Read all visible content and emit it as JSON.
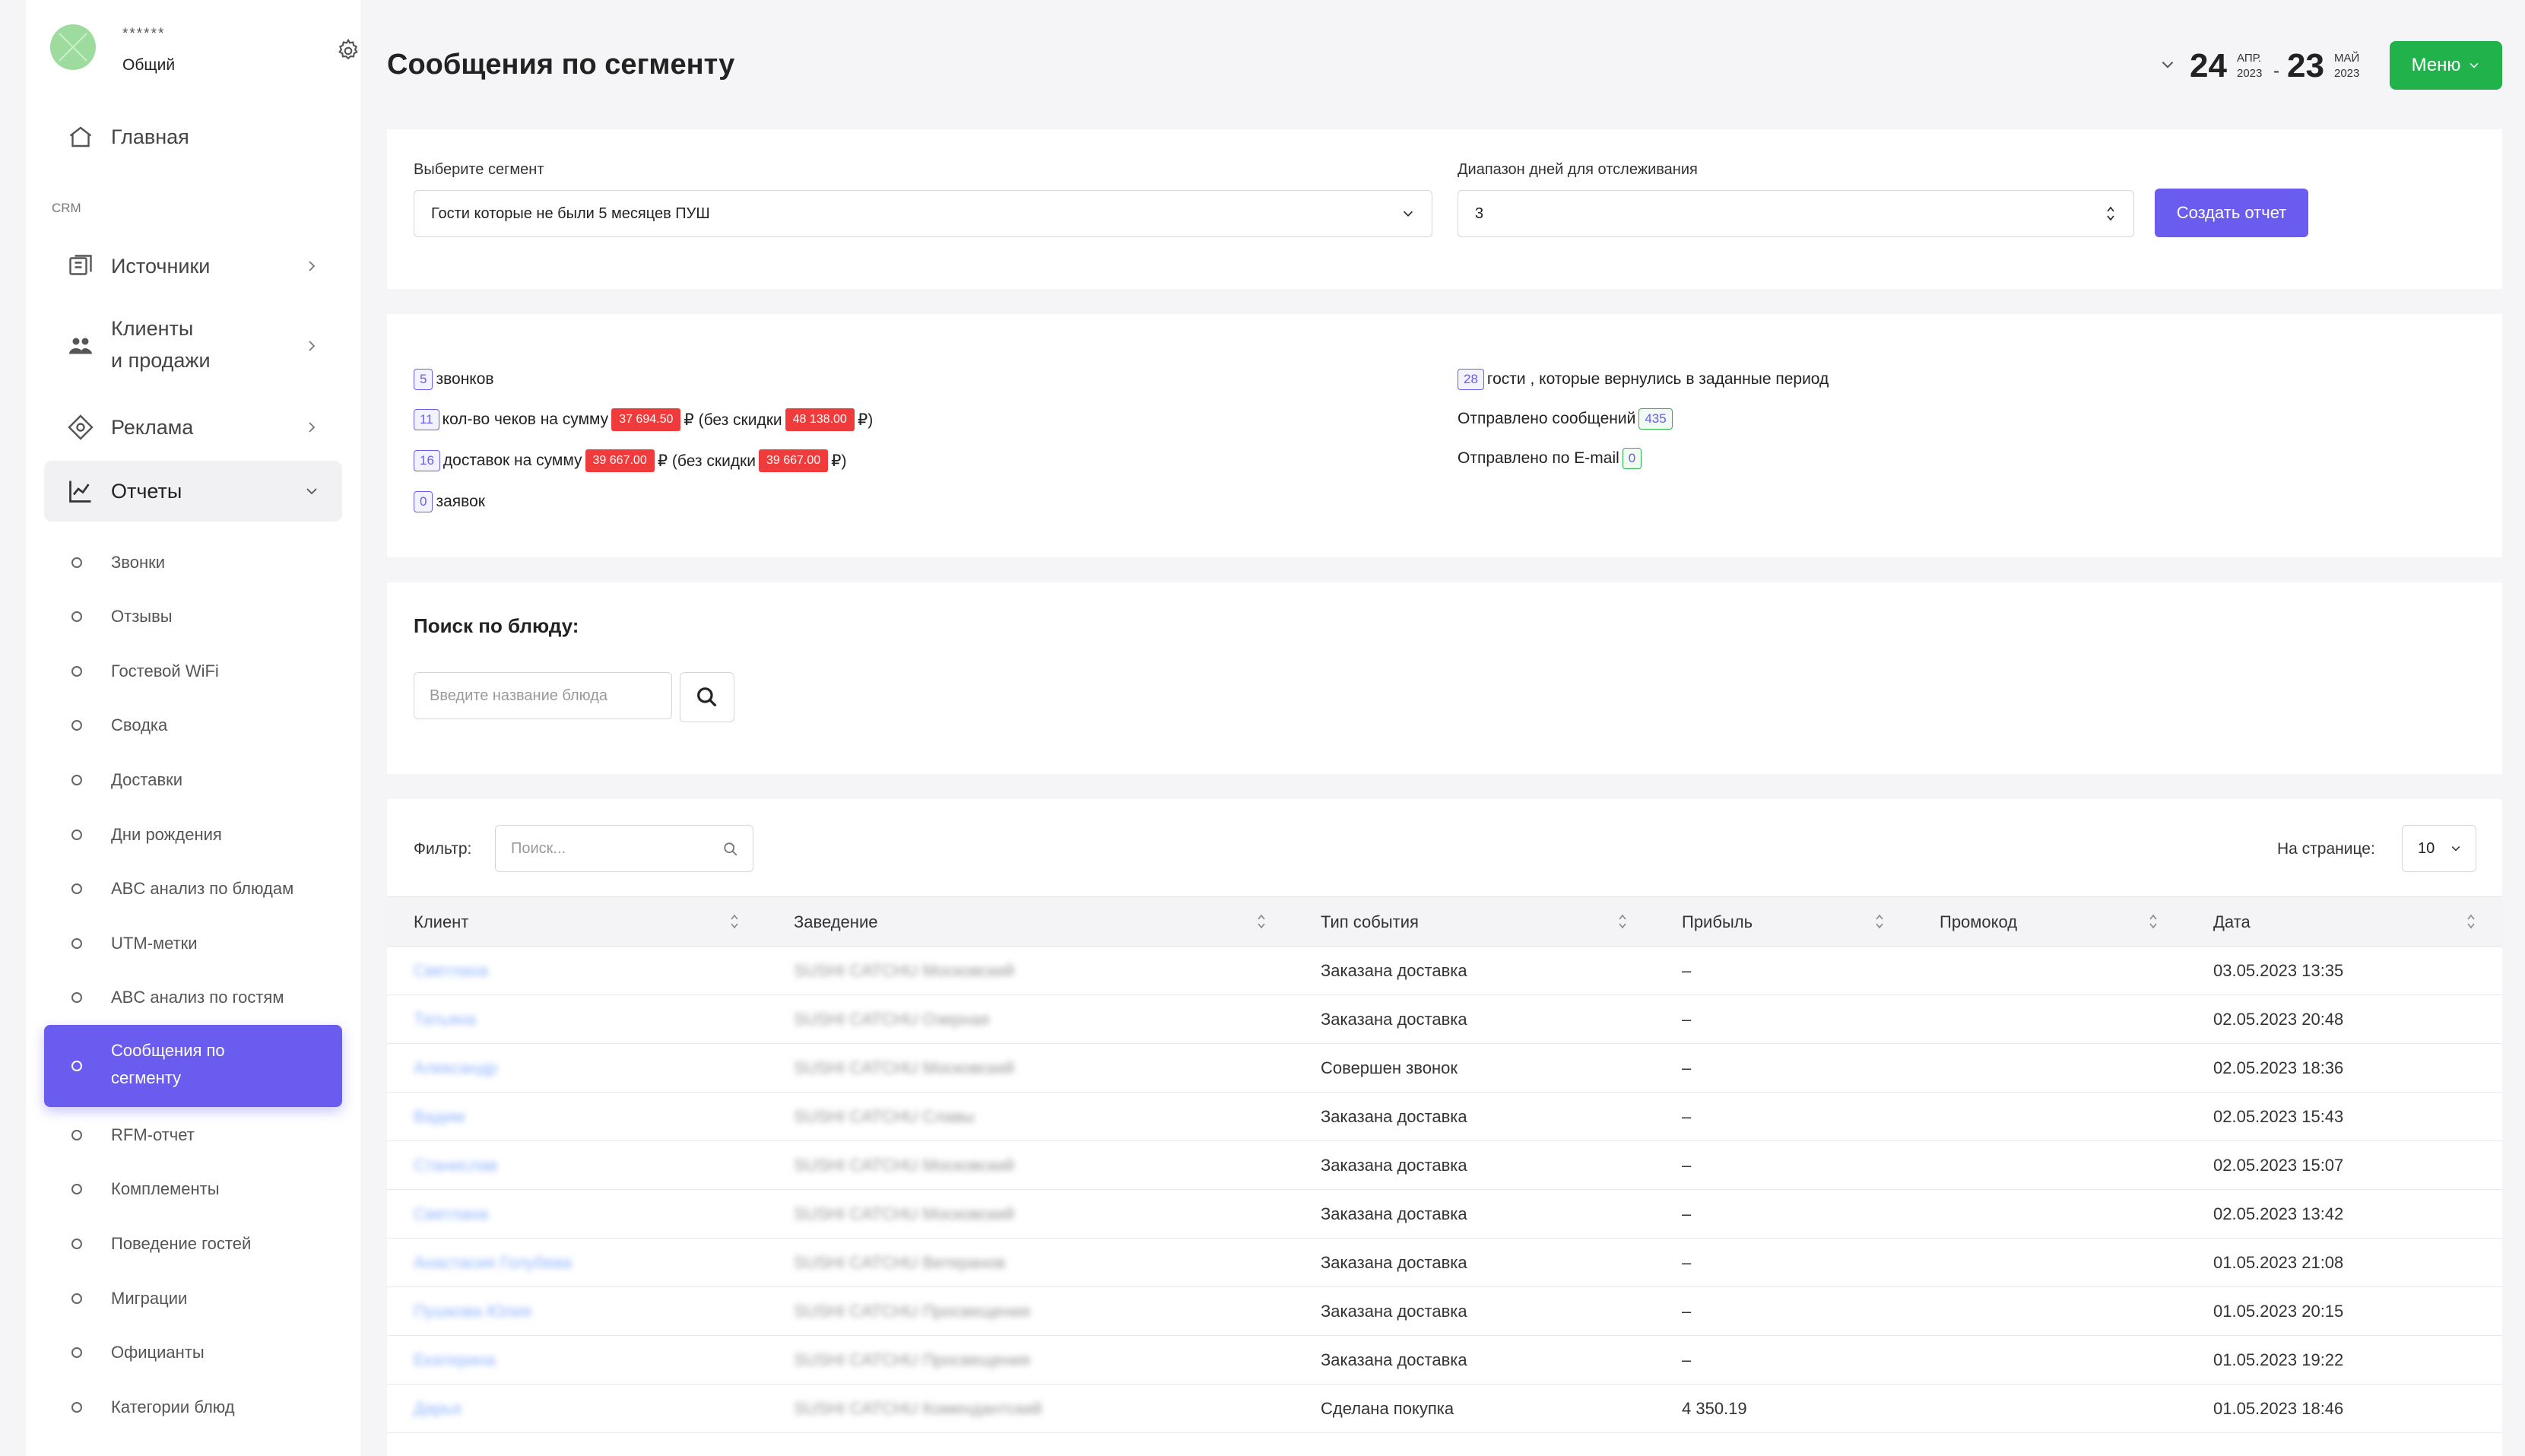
{
  "profile": {
    "name": "******",
    "org": "Общий"
  },
  "sidebar": {
    "main_items": [
      {
        "label": "Главная",
        "icon": "home-icon"
      }
    ],
    "section_label": "CRM",
    "crm_items": [
      {
        "label": "Источники",
        "icon": "sources-icon"
      },
      {
        "label": "Клиенты",
        "label2": "и продажи",
        "icon": "users-icon"
      },
      {
        "label": "Реклама",
        "icon": "ads-icon"
      },
      {
        "label": "Отчеты",
        "icon": "chart-icon"
      }
    ],
    "report_items": [
      "Звонки",
      "Отзывы",
      "Гостевой WiFi",
      "Сводка",
      "Доставки",
      "Дни рождения",
      "ABC анализ по блюдам",
      "UTM-метки",
      "ABC анализ по гостям",
      "Сообщения по",
      "сегменту",
      "RFM-отчет",
      "Комплементы",
      "Поведение гостей",
      "Миграции",
      "Официанты",
      "Категории блюд"
    ]
  },
  "header": {
    "title": "Сообщения по сегменту",
    "date_from": {
      "day": "24",
      "month": "АПР.",
      "year": "2023"
    },
    "date_sep": "-",
    "date_to": {
      "day": "23",
      "month": "МАЙ",
      "year": "2023"
    },
    "menu_label": "Меню"
  },
  "form": {
    "segment_label": "Выберите сегмент",
    "segment_value": "Гости которые не были 5 месяцев ПУШ",
    "range_label": "Диапазон дней для отслеживания",
    "range_value": "3",
    "create_label": "Создать отчет"
  },
  "stats": {
    "calls_count": "5",
    "calls_text": "звонков",
    "checks_count": "11",
    "checks_text": "кол-во чеков на сумму",
    "checks_sum": "37 694.50",
    "checks_mid": "₽ (без скидки",
    "checks_nodisc": "48 138.00",
    "checks_end": "₽)",
    "deliv_count": "16",
    "deliv_text": "доставок на сумму",
    "deliv_sum": "39 667.00",
    "deliv_mid": "₽ (без скидки",
    "deliv_nodisc": "39 667.00",
    "deliv_end": "₽)",
    "req_count": "0",
    "req_text": "заявок",
    "returned_count": "28",
    "returned_text": "гости , которые вернулись в заданные период",
    "sent_text": "Отправлено сообщений",
    "sent_count": "435",
    "email_text": "Отправлено по E-mail",
    "email_count": "0"
  },
  "dish_search": {
    "title": "Поиск по блюду:",
    "placeholder": "Введите название блюда"
  },
  "table": {
    "filter_label": "Фильтр:",
    "filter_placeholder": "Поиск...",
    "per_page_label": "На странице:",
    "per_page_value": "10",
    "columns": [
      "Клиент",
      "Заведение",
      "Тип события",
      "Прибыль",
      "Промокод",
      "Дата"
    ],
    "rows": [
      {
        "client": "Светлана",
        "venue": "SUSHI CATCHU Московский",
        "event": "Заказана доставка",
        "profit": "–",
        "promo": "",
        "date": "03.05.2023 13:35"
      },
      {
        "client": "Татьяна",
        "venue": "SUSHI CATCHU Озерная",
        "event": "Заказана доставка",
        "profit": "–",
        "promo": "",
        "date": "02.05.2023 20:48"
      },
      {
        "client": "Александр",
        "venue": "SUSHI CATCHU Московский",
        "event": "Совершен звонок",
        "profit": "–",
        "promo": "",
        "date": "02.05.2023 18:36"
      },
      {
        "client": "Вадим",
        "venue": "SUSHI CATCHU Славы",
        "event": "Заказана доставка",
        "profit": "–",
        "promo": "",
        "date": "02.05.2023 15:43"
      },
      {
        "client": "Станислав",
        "venue": "SUSHI CATCHU Московский",
        "event": "Заказана доставка",
        "profit": "–",
        "promo": "",
        "date": "02.05.2023 15:07"
      },
      {
        "client": "Светлана",
        "venue": "SUSHI CATCHU Московский",
        "event": "Заказана доставка",
        "profit": "–",
        "promo": "",
        "date": "02.05.2023 13:42"
      },
      {
        "client": "Анастасия Голубева",
        "venue": "SUSHI CATCHU Ветеранов",
        "event": "Заказана доставка",
        "profit": "–",
        "promo": "",
        "date": "01.05.2023 21:08"
      },
      {
        "client": "Пушкова Юлия",
        "venue": "SUSHI CATCHU Просвещения",
        "event": "Заказана доставка",
        "profit": "–",
        "promo": "",
        "date": "01.05.2023 20:15"
      },
      {
        "client": "Екатерина",
        "venue": "SUSHI CATCHU Просвещения",
        "event": "Заказана доставка",
        "profit": "–",
        "promo": "",
        "date": "01.05.2023 19:22"
      },
      {
        "client": "Дарья",
        "venue": "SUSHI CATCHU Комендантский",
        "event": "Сделана покупка",
        "profit": "4 350.19",
        "promo": "",
        "date": "01.05.2023 18:46"
      }
    ]
  },
  "colors": {
    "accent": "#6b5cf0",
    "success": "#22b24c",
    "danger": "#ef3b3b"
  }
}
